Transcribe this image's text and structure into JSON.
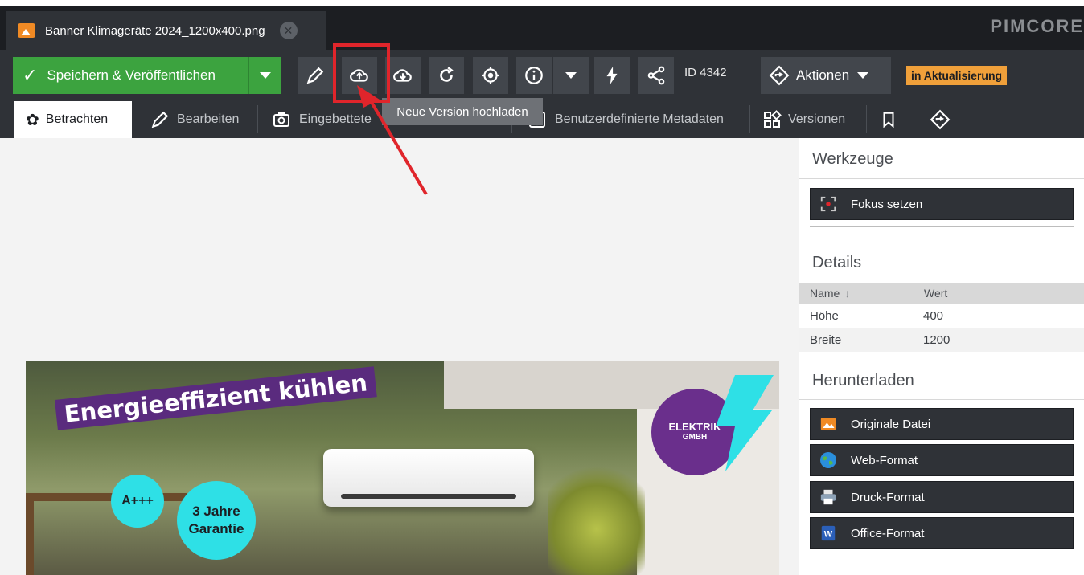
{
  "file_tab": {
    "title": "Banner Klimageräte 2024_1200x400.png"
  },
  "logo": "PIMCORE",
  "toolbar": {
    "save_label": "Speichern & Veröffentlichen",
    "id_label": "ID 4342",
    "aktionen_label": "Aktionen",
    "status_badge": "in Aktualisierung",
    "tooltip": "Neue Version hochladen"
  },
  "tabs": [
    {
      "label": "Betrachten"
    },
    {
      "label": "Bearbeiten"
    },
    {
      "label": "Eingebettete"
    },
    {
      "label": "Benutzerdefinierte Metadaten"
    },
    {
      "label": "Versionen"
    }
  ],
  "preview": {
    "slogan": "Energieeffizient kühlen",
    "badge_a": "A+++",
    "badge_warranty_line1": "3 Jahre",
    "badge_warranty_line2": "Garantie",
    "brand_line1": "ELEKTRIK",
    "brand_line2": "GMBH"
  },
  "panel": {
    "werkzeuge_title": "Werkzeuge",
    "fokus_label": "Fokus setzen",
    "details_title": "Details",
    "col_name": "Name",
    "col_wert": "Wert",
    "rows": [
      {
        "name": "Höhe",
        "wert": "400"
      },
      {
        "name": "Breite",
        "wert": "1200"
      }
    ],
    "download_title": "Herunterladen",
    "downloads": [
      {
        "label": "Originale Datei",
        "icon": "image-icon"
      },
      {
        "label": "Web-Format",
        "icon": "globe-icon"
      },
      {
        "label": "Druck-Format",
        "icon": "printer-icon"
      },
      {
        "label": "Office-Format",
        "icon": "word-icon"
      }
    ]
  },
  "colors": {
    "save_green": "#3ca33f",
    "toolbar_dark": "#2f3237",
    "status_orange": "#f0a03a",
    "highlight_red": "#e0252b"
  }
}
